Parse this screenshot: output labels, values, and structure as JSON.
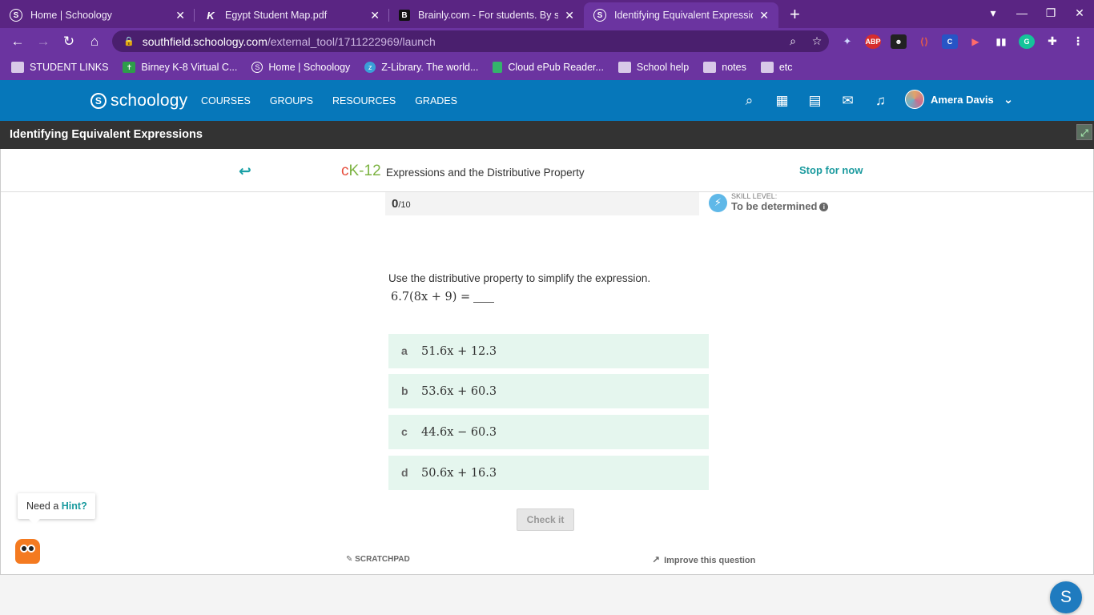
{
  "browser": {
    "tabs": [
      {
        "title": "Home | Schoology",
        "favicon": "schoology-icon"
      },
      {
        "title": "Egypt Student Map.pdf",
        "favicon": "kami-icon"
      },
      {
        "title": "Brainly.com - For students. By st",
        "favicon": "brainly-icon"
      },
      {
        "title": "Identifying Equivalent Expressio",
        "favicon": "schoology-icon"
      }
    ],
    "url_domain": "southfield.schoology.com",
    "url_path": "/external_tool/1711222969/launch",
    "bookmarks": [
      {
        "label": "STUDENT LINKS",
        "icon": "folder-icon"
      },
      {
        "label": "Birney K-8 Virtual C...",
        "icon": "birney-icon"
      },
      {
        "label": "Home | Schoology",
        "icon": "schoology-icon"
      },
      {
        "label": "Z-Library. The world...",
        "icon": "zlibrary-icon"
      },
      {
        "label": "Cloud ePub Reader...",
        "icon": "epub-icon"
      },
      {
        "label": "School help",
        "icon": "folder-icon"
      },
      {
        "label": "notes",
        "icon": "folder-icon"
      },
      {
        "label": "etc",
        "icon": "folder-icon"
      }
    ],
    "extension_labels": {
      "abp": "ABP",
      "c": "C",
      "g": "G"
    }
  },
  "schoology": {
    "logo_text": "schoology",
    "nav": [
      "COURSES",
      "GROUPS",
      "RESOURCES",
      "GRADES"
    ],
    "user_name": "Amera Davis"
  },
  "page_title": "Identifying Equivalent Expressions",
  "ck12": {
    "brand_c": "c",
    "brand_rest": "K-12",
    "concept": "Expressions and the Distributive Property",
    "stop_label": "Stop for now",
    "score": "0",
    "score_total": "/10",
    "skill_label": "SKILL LEVEL:",
    "skill_value": "To be determined",
    "question": "Use the distributive property to simplify the expression.",
    "expression": "6.7(8x + 9) =",
    "options": [
      {
        "letter": "a",
        "text": "51.6x + 12.3"
      },
      {
        "letter": "b",
        "text": "53.6x + 60.3"
      },
      {
        "letter": "c",
        "text": "44.6x − 60.3"
      },
      {
        "letter": "d",
        "text": "50.6x + 16.3"
      }
    ],
    "check_label": "Check it",
    "scratchpad_label": "SCRATCHPAD",
    "improve_label": "Improve this question",
    "hint_prefix": "Need a ",
    "hint_link": "Hint?",
    "help_button": "S"
  },
  "colors": {
    "browser_frame": "#6b34a0",
    "schoology_blue": "#0677ba",
    "title_bar": "#333333",
    "option_bg": "#e5f6ee",
    "ck12_teal": "#1a9a9e"
  }
}
